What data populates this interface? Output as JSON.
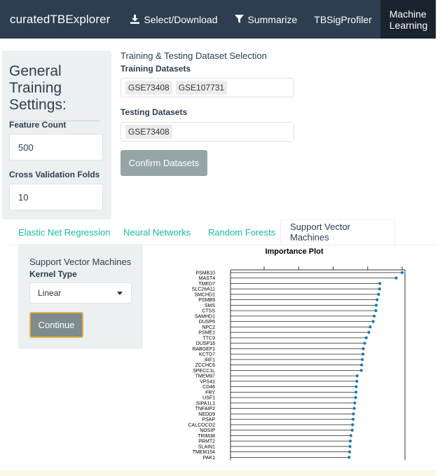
{
  "navbar": {
    "brand": "curatedTBExplorer",
    "items": [
      {
        "label": "Select/Download",
        "icon": "download-icon"
      },
      {
        "label": "Summarize",
        "icon": "filter-icon"
      },
      {
        "label": "TBSigProfiler",
        "icon": ""
      },
      {
        "label": "Machine Learning",
        "icon": "",
        "active": true
      }
    ]
  },
  "sidebar": {
    "title": "General Training Settings:",
    "feature_count_label": "Feature Count",
    "feature_count_value": "500",
    "cv_folds_label": "Cross Validation Folds",
    "cv_folds_value": "10"
  },
  "datasets": {
    "section_title": "Training & Testing Dataset Selection",
    "training_label": "Training Datasets",
    "training_values": [
      "GSE73408",
      "GSE107731"
    ],
    "testing_label": "Testing Datasets",
    "testing_values": [
      "GSE73408"
    ],
    "confirm_label": "Confirm Datasets"
  },
  "tabs": [
    {
      "label": "Elastic Net Regression",
      "active": false
    },
    {
      "label": "Neural Networks",
      "active": false
    },
    {
      "label": "Random Forests",
      "active": false
    },
    {
      "label": "Support Vector Machines",
      "active": true
    }
  ],
  "svm": {
    "title": "Support Vector Machines",
    "kernel_label": "Kernel Type",
    "kernel_value": "Linear",
    "continue_label": "Continue"
  },
  "colors": {
    "navbar": "#2c3e50",
    "navbar_active": "#1a242f",
    "tab_link": "#18bc9c",
    "point": "#1f77b4",
    "button_border": "#e3b03f"
  },
  "chart_data": {
    "type": "scatter",
    "title": "Importance Plot",
    "categories": [
      "PSMB10",
      "MAST4",
      "TMED7",
      "SLC26A11",
      "SMCHD1",
      "PSMB9",
      "SMS",
      "CTSS",
      "SAMHD1",
      "DUSP6",
      "NPC2",
      "PSME1",
      "TTC9",
      "DUSP16",
      "RABGEF1",
      "KCTD7",
      "IRF1",
      "ZCCHC6",
      "SPECC1L",
      "TMEM97",
      "VPS41",
      "CD46",
      "FRY",
      "USF1",
      "SIPA1L1",
      "TNFAIP2",
      "NEDD9",
      "PSAP",
      "CALCOCO2",
      "NOSIP",
      "TRIM38",
      "PRMT2",
      "SLAIN1",
      "TMEM154",
      "PAK1"
    ],
    "values": [
      100,
      96.5,
      87,
      86.8,
      86.3,
      85.4,
      84.9,
      84.7,
      83.7,
      83.1,
      81.4,
      80.6,
      79.1,
      78.2,
      77.4,
      77.2,
      76.8,
      76.4,
      76.2,
      73.8,
      73.6,
      73.2,
      73.1,
      72.9,
      72.4,
      72.1,
      71.6,
      71.4,
      71.1,
      70.9,
      70.1,
      69.8,
      69.6,
      69.4,
      69.1
    ],
    "xlim": [
      0,
      100
    ],
    "grid": false,
    "legend": "none"
  }
}
